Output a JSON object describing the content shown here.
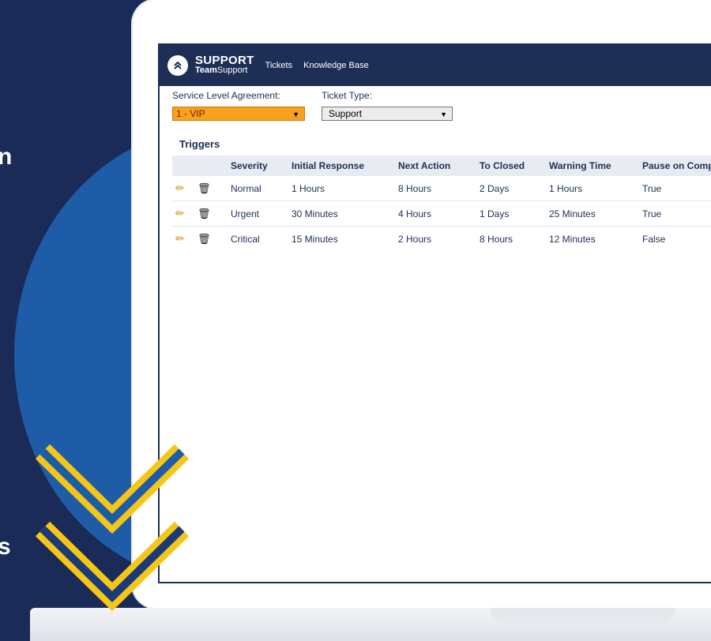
{
  "side_text": {
    "top_char": "n",
    "bottom_char": "s"
  },
  "nav": {
    "logo_main": "SUPPORT",
    "logo_sub_bold": "Team",
    "logo_sub": "Support",
    "links": [
      "Tickets",
      "Knowledge Base"
    ]
  },
  "filters": {
    "sla_label": "Service Level Agreement:",
    "sla_value": "1 - VIP",
    "type_label": "Ticket Type:",
    "type_value": "Support"
  },
  "triggers": {
    "title": "Triggers",
    "columns": [
      "Severity",
      "Initial Response",
      "Next Action",
      "To Closed",
      "Warning Time",
      "Pause on Comp"
    ],
    "rows": [
      [
        "Normal",
        "1 Hours",
        "8 Hours",
        "2 Days",
        "1 Hours",
        "True"
      ],
      [
        "Urgent",
        "30 Minutes",
        "4 Hours",
        "1 Days",
        "25 Minutes",
        "True"
      ],
      [
        "Critical",
        "15 Minutes",
        "2 Hours",
        "8 Hours",
        "12 Minutes",
        "False"
      ]
    ]
  },
  "icons": {
    "edit": "pencil-icon",
    "delete": "trash-icon",
    "logo": "chevron-up-logo-icon",
    "dropdown": "caret-down-icon"
  },
  "colors": {
    "navy": "#1e2f55",
    "page_bg": "#1b2b57",
    "circle": "#1f5ca8",
    "accent_orange": "#f7a11c",
    "check_yellow": "#f5c518"
  }
}
